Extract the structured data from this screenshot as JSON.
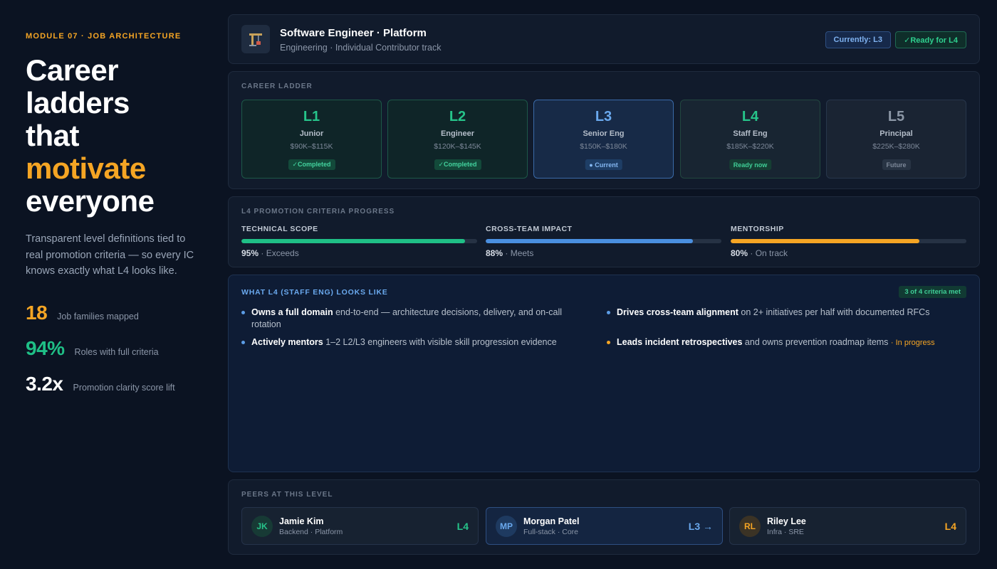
{
  "hero": {
    "module_tag": "MODULE 07 · JOB ARCHITECTURE",
    "headline_lines": [
      "Career",
      "ladders",
      "that"
    ],
    "headline_accent": "motivate",
    "headline_last": "everyone",
    "lede": "Transparent level definitions tied to real promotion criteria — so every IC knows exactly what L4 looks like.",
    "stats": [
      {
        "value": "18",
        "label": "Job families mapped",
        "color": "#f5a524"
      },
      {
        "value": "94%",
        "label": "Roles with full criteria",
        "color": "#1fbf86"
      },
      {
        "value": "3.2x",
        "label": "Promotion clarity score lift",
        "color": "#ffffff"
      }
    ]
  },
  "role": {
    "icon": "construction-crane-icon",
    "title": "Software Engineer · Platform",
    "subtitle": "Engineering · Individual Contributor track",
    "current_pill": "Currently: L3",
    "ready_pill": "✓Ready for L4"
  },
  "ladder": {
    "label": "CAREER LADDER",
    "levels": [
      {
        "code": "L1",
        "name": "Junior",
        "pay": "$90K–$115K",
        "status": "✓Completed",
        "state": "done"
      },
      {
        "code": "L2",
        "name": "Engineer",
        "pay": "$120K–$145K",
        "status": "✓Completed",
        "state": "done"
      },
      {
        "code": "L3",
        "name": "Senior Eng",
        "pay": "$150K–$180K",
        "status": "● Current",
        "state": "current"
      },
      {
        "code": "L4",
        "name": "Staff Eng",
        "pay": "$185K–$220K",
        "status": "Ready now",
        "state": "ready"
      },
      {
        "code": "L5",
        "name": "Principal",
        "pay": "$225K–$280K",
        "status": "Future",
        "state": "future"
      }
    ]
  },
  "criteria": {
    "label": "L4 PROMOTION CRITERIA PROGRESS",
    "items": [
      {
        "name": "TECHNICAL SCOPE",
        "value": 95,
        "value_text": "95%",
        "note": "· Exceeds",
        "color": "#1fbf86"
      },
      {
        "name": "CROSS-TEAM IMPACT",
        "value": 88,
        "value_text": "88%",
        "note": "· Meets",
        "color": "#4a8fe0"
      },
      {
        "name": "MENTORSHIP",
        "value": 80,
        "value_text": "80%",
        "note": "· On track",
        "color": "#f5a524"
      }
    ]
  },
  "looks_like": {
    "title": "WHAT L4 (STAFF ENG) LOOKS LIKE",
    "met_badge": "3 of 4 criteria met",
    "bullets": [
      {
        "bold": "Owns a full domain",
        "rest": " end-to-end — architecture decisions, delivery, and on-call rotation",
        "note": ""
      },
      {
        "bold": "Drives cross-team alignment",
        "rest": " on 2+ initiatives per half with documented RFCs",
        "note": ""
      },
      {
        "bold": "Actively mentors",
        "rest": " 1–2 L2/L3 engineers with visible skill progression evidence",
        "note": ""
      },
      {
        "bold": "Leads incident retrospectives",
        "rest": " and owns prevention roadmap items ",
        "note": "· In progress"
      }
    ]
  },
  "peers": {
    "label": "PEERS AT THIS LEVEL",
    "items": [
      {
        "initials": "JK",
        "name": "Jamie Kim",
        "role": "Backend · Platform",
        "level": "L4",
        "color": "#26c48a",
        "avatar_bg": "#173a35"
      },
      {
        "initials": "MP",
        "name": "Morgan Patel",
        "role": "Full-stack · Core",
        "level": "L3 →",
        "color": "#6aa9ee",
        "avatar_bg": "#1e3a60"
      },
      {
        "initials": "RL",
        "name": "Riley Lee",
        "role": "Infra · SRE",
        "level": "L4",
        "color": "#f5a524",
        "avatar_bg": "#3b3325"
      }
    ]
  }
}
